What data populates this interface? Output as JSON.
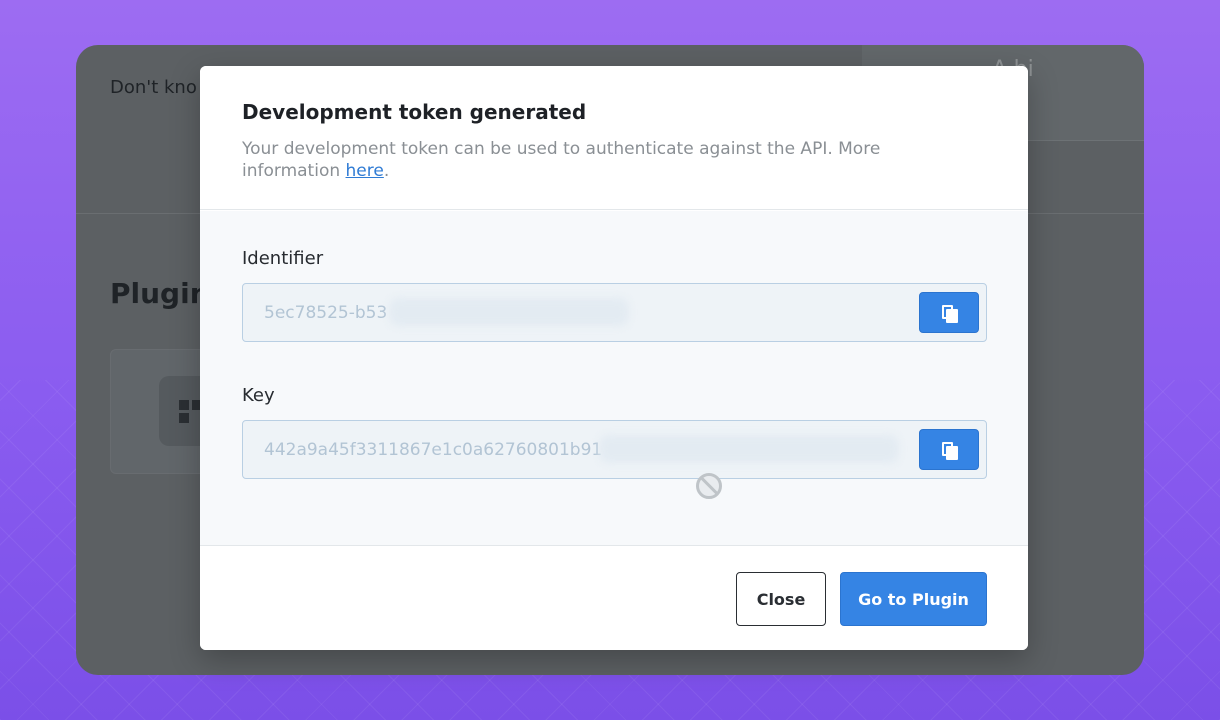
{
  "background_app": {
    "hint_text": "Don't kno",
    "section_title": "Plugins",
    "top_right_text": "A.bi"
  },
  "modal": {
    "title": "Development token generated",
    "description_prefix": "Your development token can be used to authenticate against the API. More information ",
    "description_link": "here",
    "description_suffix": ".",
    "identifier": {
      "label": "Identifier",
      "value": "5ec78525-b53"
    },
    "key": {
      "label": "Key",
      "value": "442a9a45f3311867e1c0a62760801b91"
    },
    "buttons": {
      "close": "Close",
      "go_to_plugin": "Go to Plugin"
    }
  },
  "icons": {
    "copy": "copy-icon",
    "cursor": "not-allowed-cursor-icon"
  },
  "colors": {
    "accent": "#3584e4",
    "overlay": "#5c6063",
    "background": "#8a5cf0"
  }
}
